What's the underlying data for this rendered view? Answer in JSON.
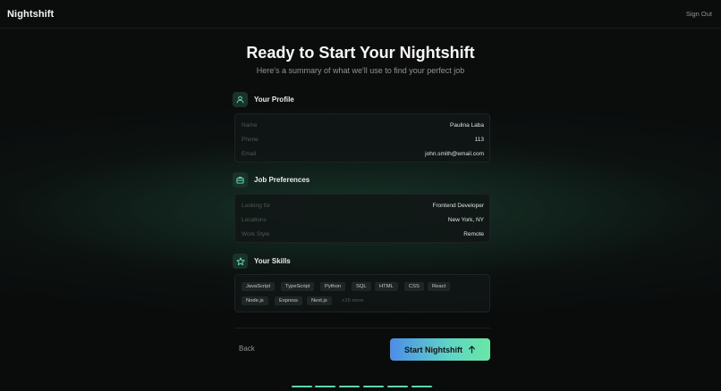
{
  "header": {
    "brand": "Nightshift",
    "signout_label": "Sign Out"
  },
  "main": {
    "title": "Ready to Start Your Nightshift",
    "subtitle": "Here's a summary of what we'll use to find your perfect job"
  },
  "profile": {
    "title": "Your Profile",
    "icon": "user-icon",
    "rows": [
      {
        "label": "Name",
        "value": "Paulina Laba"
      },
      {
        "label": "Phone",
        "value": "113"
      },
      {
        "label": "Email",
        "value": "john.smith@email.com"
      }
    ]
  },
  "preferences": {
    "title": "Job Preferences",
    "icon": "briefcase-icon",
    "rows": [
      {
        "label": "Looking for",
        "value": "Frontend Developer"
      },
      {
        "label": "Locations",
        "value": "New York, NY"
      },
      {
        "label": "Work Style",
        "value": "Remote"
      }
    ]
  },
  "skills": {
    "title": "Your Skills",
    "icon": "star-icon",
    "chips": [
      "JavaScript",
      "TypeScript",
      "Python",
      "SQL",
      "HTML",
      "CSS",
      "React",
      "Node.js",
      "Express",
      "Next.js"
    ],
    "more_label": "+26 more"
  },
  "footer": {
    "back_label": "Back",
    "start_label": "Start Nightshift",
    "start_icon": "arrow-up-icon"
  },
  "progress": {
    "steps_total": 6,
    "steps_complete": 6
  },
  "colors": {
    "accent": "#5ad8b5",
    "button_gradient_start": "#4c8de8",
    "button_gradient_end": "#6be6a3",
    "background": "#0b0d0d"
  }
}
